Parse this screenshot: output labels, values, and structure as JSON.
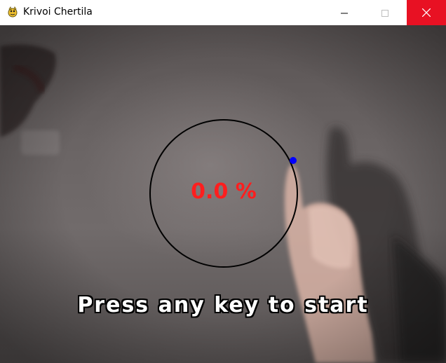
{
  "window": {
    "title": "Krivoi Chertila",
    "app_icon": "pygame-snake-icon",
    "controls": {
      "minimize_icon": "minimize-icon",
      "maximize_icon": "maximize-icon",
      "close_icon": "close-icon",
      "close_color": "#e81123"
    }
  },
  "game": {
    "progress_text": "0.0 %",
    "progress_value": 0.0,
    "prompt": "Press any key to start",
    "colors": {
      "progress_text": "#ff1e1e",
      "circle_stroke": "#000000",
      "cursor_dot": "#0000ff",
      "prompt_text": "#ffffff",
      "prompt_outline": "#000000"
    },
    "background": "camera-feed"
  }
}
